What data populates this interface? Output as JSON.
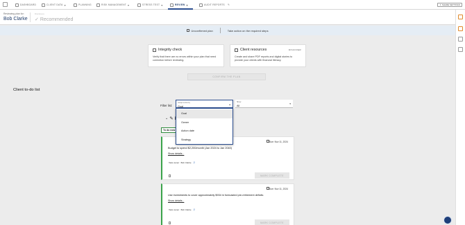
{
  "nav": {
    "items": [
      {
        "label": "Dashboard",
        "icon": "dashboard-icon"
      },
      {
        "label": "Client Data",
        "icon": "client-data-icon"
      },
      {
        "label": "Planning",
        "icon": "planning-icon"
      },
      {
        "label": "Risk Management",
        "icon": "risk-icon"
      },
      {
        "label": "Stress Test",
        "icon": "stress-test-icon"
      },
      {
        "label": "Review",
        "icon": "review-icon"
      },
      {
        "label": "Audit Reports",
        "icon": "audit-icon"
      }
    ],
    "share_label": "Share Settings",
    "accent": "#2a4d8f"
  },
  "header": {
    "reviewing_label": "Reviewing plan for:",
    "client_name": "Bob Clarke",
    "step_label": "Disclosure",
    "step_name": "Recommended"
  },
  "banner": {
    "status": "Unconfirmed plan",
    "action": "Take action on the required steps"
  },
  "cards": [
    {
      "title": "Integrity check",
      "desc": "Verify that there are no errors within your plan that need correction before reviewing.",
      "link": ""
    },
    {
      "title": "Client resources",
      "desc": "Create and share PDF reports and digital stories to provide your clients with financial literacy.",
      "link": "Discover"
    }
  ],
  "confirm_label": "Confirm the plan",
  "section_title": "Client to-do list",
  "filter": {
    "label": "Filter list:",
    "group_small": "Group to-dos by",
    "group_value": "Goal",
    "show_small": "Show",
    "show_value": "All",
    "options": [
      "Goal",
      "Owner",
      "Action date",
      "Strategy"
    ]
  },
  "review_head": "Re",
  "todo_tab": "To do now",
  "tasks": [
    {
      "due": "Due: Nov 11, 2024",
      "title": "Budget to spend $2,200/month (Jan 2024 to Jan 2040)",
      "details": "Show details...",
      "owner": "Task owner : Bob Clarke",
      "mark": "Mark complete"
    },
    {
      "due": "Due: Nov 11, 2024",
      "title": "Use investments to cover approximately $934 in forecasted pre-retirement deficits",
      "details": "Show details...",
      "owner": "Task owner : Bob Clarke",
      "mark": "Mark complete"
    }
  ]
}
